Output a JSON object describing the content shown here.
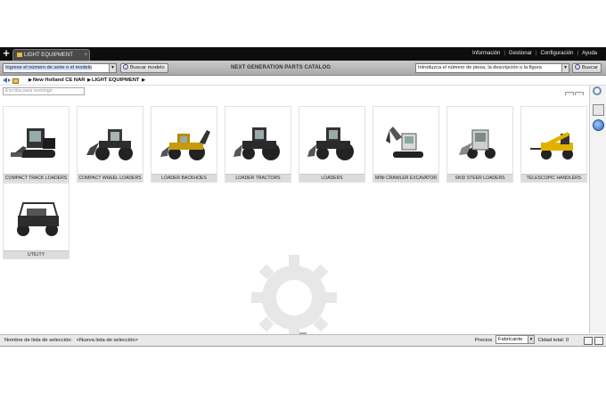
{
  "app": {
    "tab_label": "LIGHT EQUIPMENT",
    "tab_close": "×",
    "new_tab": "+",
    "menu": [
      "Información",
      "Gestionar",
      "Configuración",
      "Ayuda"
    ]
  },
  "toolbar": {
    "serial_placeholder": "Ingrese el número de serie o el modelo",
    "search_model_label": "Buscar modelo",
    "catalog_title": "NEXT GENERATION PARTS CATALOG",
    "part_placeholder": "Introduzca el número de pieza, la descripción o la figura",
    "search_label": "Buscar"
  },
  "breadcrumb": {
    "items": [
      "New Holland CE NAR",
      "LIGHT EQUIPMENT"
    ]
  },
  "filter": {
    "placeholder": "Escriba para restringir"
  },
  "tiles": [
    {
      "label": "COMPACT TRACK LOADERS",
      "icon": "compact-track-loader-icon"
    },
    {
      "label": "COMPACT WHEEL LOADERS",
      "icon": "compact-wheel-loader-icon"
    },
    {
      "label": "LOADER BACKHOES",
      "icon": "loader-backhoe-icon"
    },
    {
      "label": "LOADER TRACTORS",
      "icon": "loader-tractor-icon"
    },
    {
      "label": "LOADERS",
      "icon": "loader-icon"
    },
    {
      "label": "MINI CRAWLER EXCAVATOR",
      "icon": "mini-excavator-icon"
    },
    {
      "label": "SKID STEER LOADERS",
      "icon": "skid-steer-loader-icon"
    },
    {
      "label": "TELESCOPIC HANDLERS",
      "icon": "telescopic-handler-icon"
    },
    {
      "label": "UTILITY",
      "icon": "utility-vehicle-icon"
    }
  ],
  "status": {
    "selection_list_label": "Nombre de lista de selección:",
    "selection_list_value": "<Nueva lista de selección>",
    "prices_label": "Precios",
    "prices_value": "Fabricante",
    "total_qty": "Ctdad total: 0"
  },
  "colors": {
    "topbar": "#0d0d0d",
    "toolbar": "#b9b9b9",
    "accent_blue": "#3a6fc4",
    "machine_yellow": "#e2b100"
  }
}
